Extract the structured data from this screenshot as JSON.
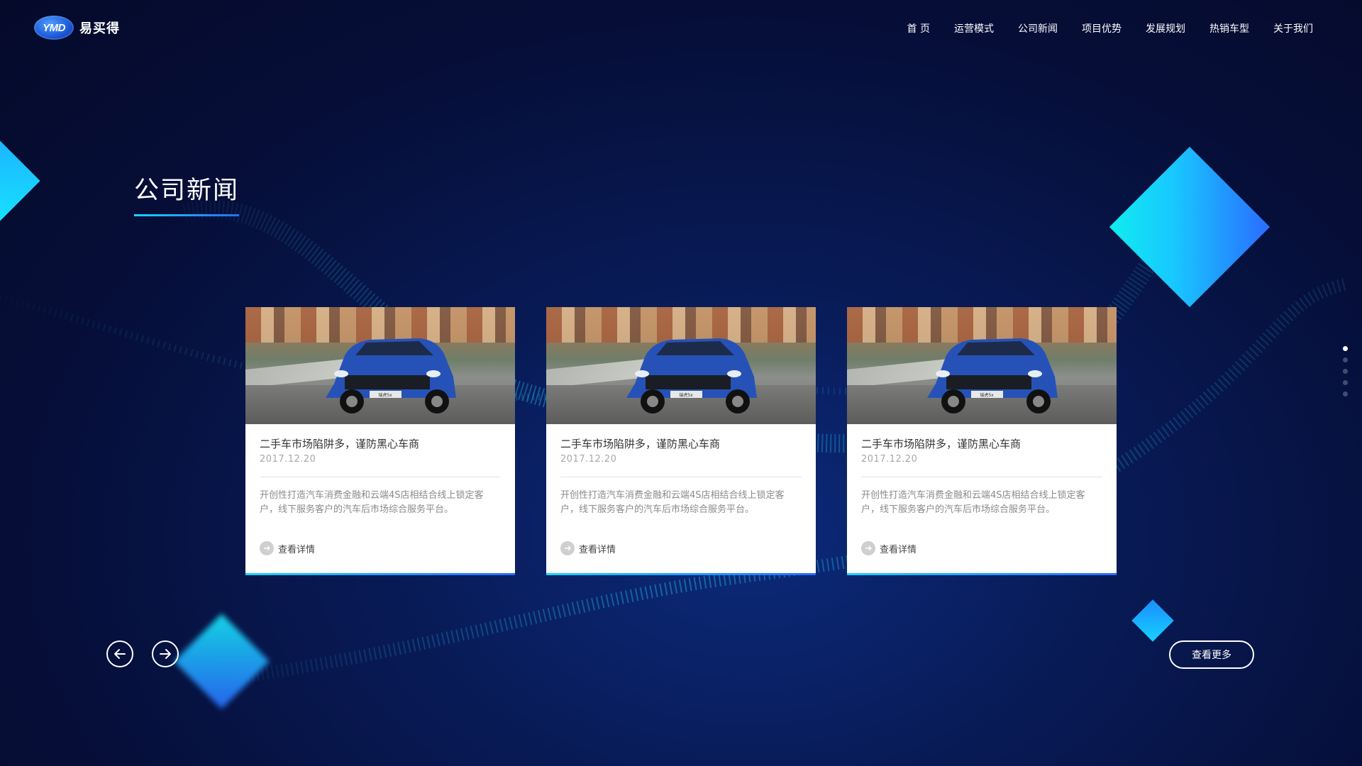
{
  "header": {
    "logo_badge": "YMD",
    "logo_name": "易买得",
    "nav": [
      {
        "label": "首 页"
      },
      {
        "label": "运营模式"
      },
      {
        "label": "公司新闻"
      },
      {
        "label": "项目优势"
      },
      {
        "label": "发展规划"
      },
      {
        "label": "热销车型"
      },
      {
        "label": "关于我们"
      }
    ]
  },
  "section": {
    "title": "公司新闻"
  },
  "cards": [
    {
      "title": "二手车市场陷阱多，谨防黑心车商",
      "date": "2017.12.20",
      "description": "开创性打造汽车消费金融和云端4S店相结合线上锁定客户，线下服务客户的汽车后市场综合服务平台。",
      "more_label": "查看详情",
      "plate": "瑞虎5x"
    },
    {
      "title": "二手车市场陷阱多，谨防黑心车商",
      "date": "2017.12.20",
      "description": "开创性打造汽车消费金融和云端4S店相结合线上锁定客户，线下服务客户的汽车后市场综合服务平台。",
      "more_label": "查看详情",
      "plate": "瑞虎5x"
    },
    {
      "title": "二手车市场陷阱多，谨防黑心车商",
      "date": "2017.12.20",
      "description": "开创性打造汽车消费金融和云端4S店相结合线上锁定客户，线下服务客户的汽车后市场综合服务平台。",
      "more_label": "查看详情",
      "plate": "瑞虎5x"
    }
  ],
  "more_button": "查看更多",
  "pagination": {
    "count": 5,
    "active": 0
  },
  "colors": {
    "accent_cyan": "#17d6ff",
    "accent_blue": "#2a6cff",
    "background": "#060f3a"
  }
}
